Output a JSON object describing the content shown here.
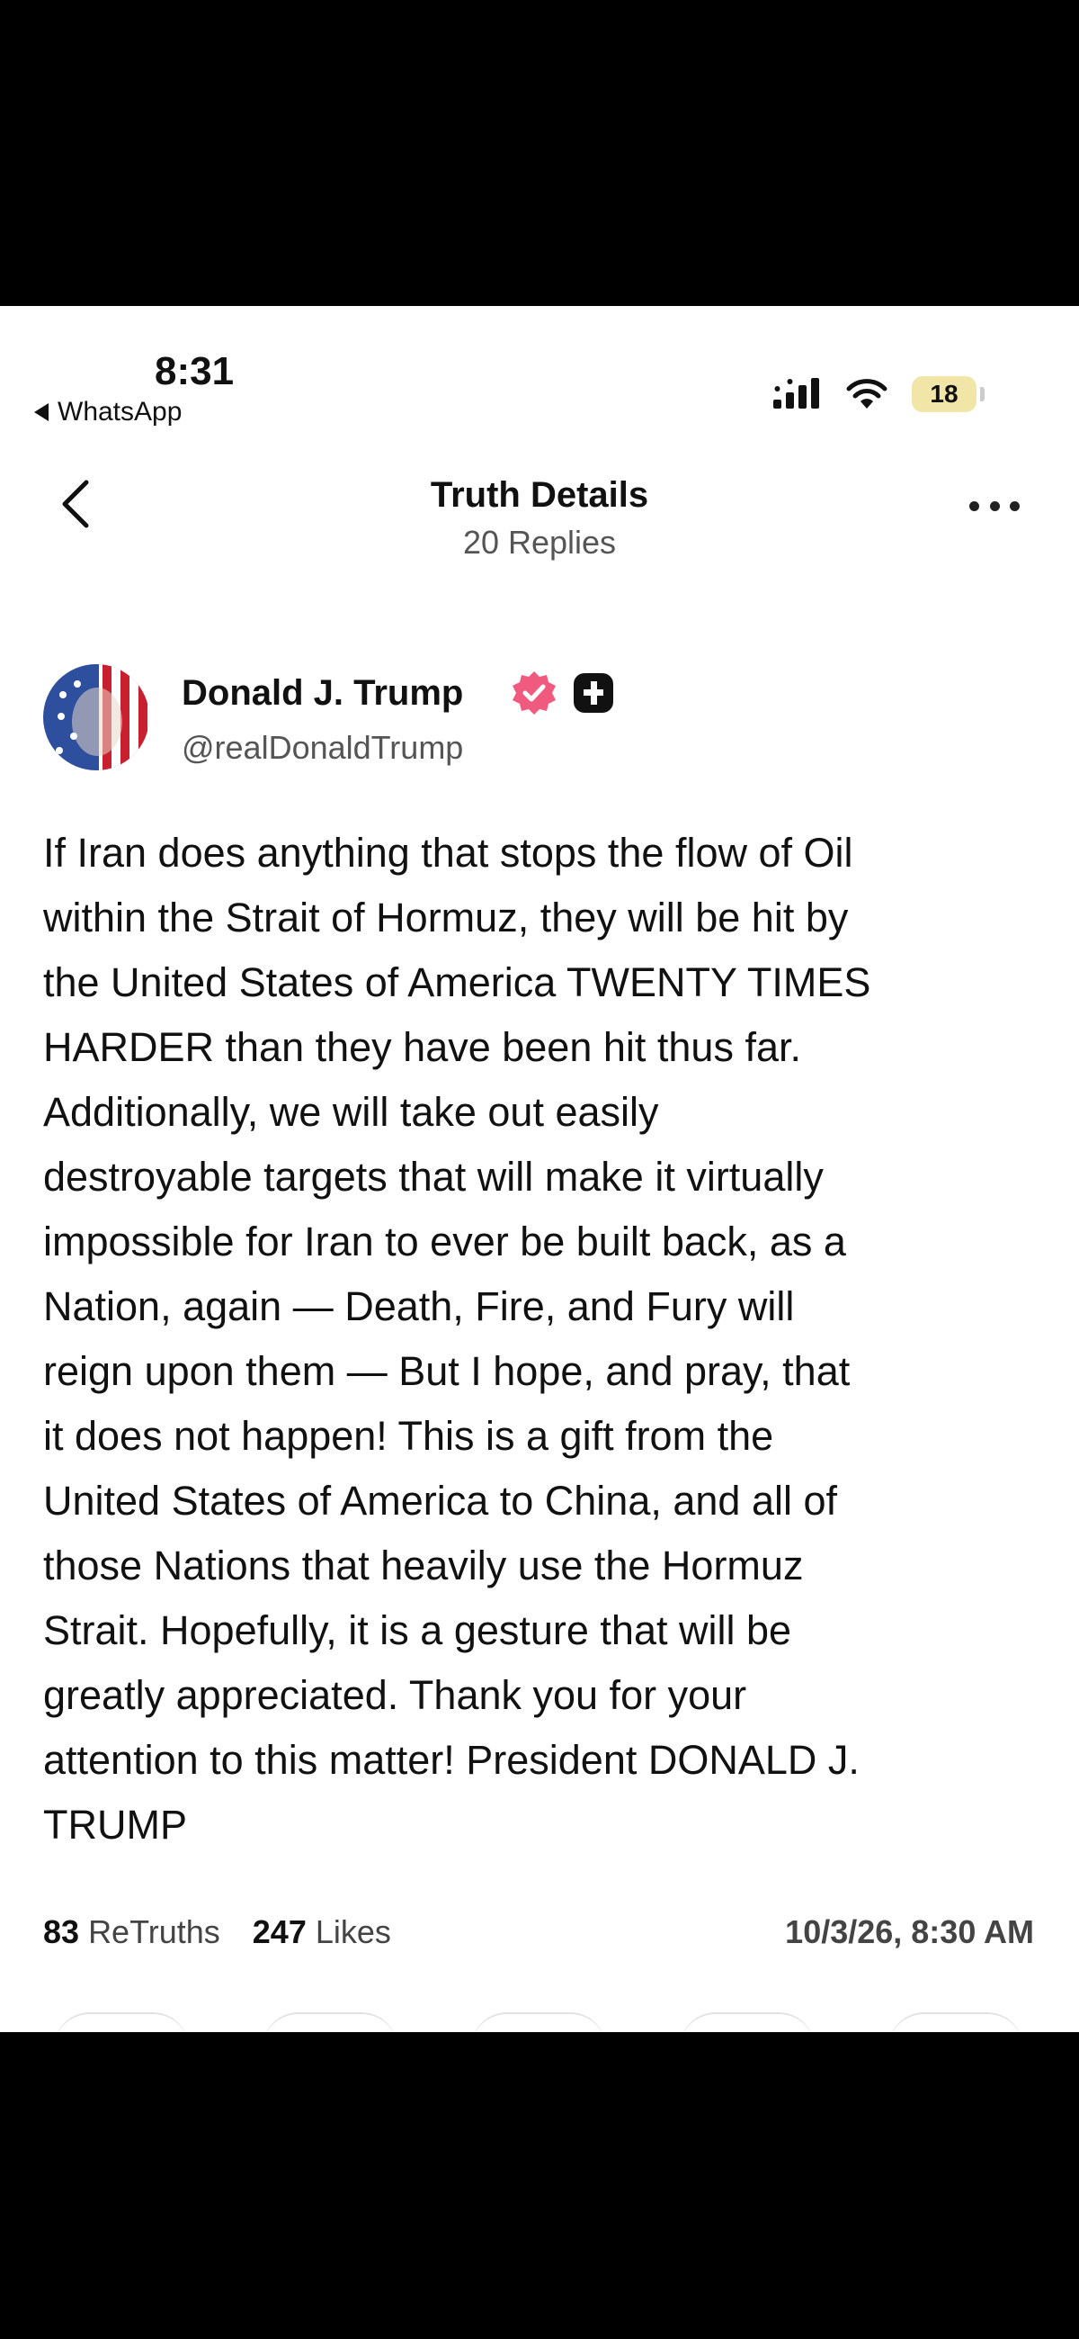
{
  "status_bar": {
    "time": "8:31",
    "back_app": "WhatsApp",
    "battery": "18",
    "battery_color": "#f1e6a8"
  },
  "header": {
    "title": "Truth Details",
    "subtitle": "20 Replies",
    "back_icon": "chevron-left-icon",
    "more_icon": "more-horizontal-icon"
  },
  "post": {
    "author_name": "Donald J. Trump",
    "author_handle": "@realDonaldTrump",
    "verified_color": "#f05a7e",
    "body": "If Iran does anything that stops the flow of Oil\nwithin the Strait of Hormuz, they will be hit by\nthe United States of America TWENTY TIMES\nHARDER than they have been hit thus far.\nAdditionally, we will take out easily\ndestroyable targets that will make it virtually\nimpossible for Iran to ever be built back, as a\nNation, again — Death, Fire, and Fury will\nreign upon them — But I hope, and pray, that\nit does not happen! This is a gift from the\nUnited States of America to China, and all of\nthose Nations that heavily use the Hormuz\nStrait. Hopefully, it is a gesture that will be\ngreatly appreciated. Thank you for your\nattention to this matter! President DONALD J.\nTRUMP",
    "retruths_count": "83",
    "retruths_label": "ReTruths",
    "likes_count": "247",
    "likes_label": "Likes",
    "timestamp": "10/3/26, 8:30 AM"
  }
}
